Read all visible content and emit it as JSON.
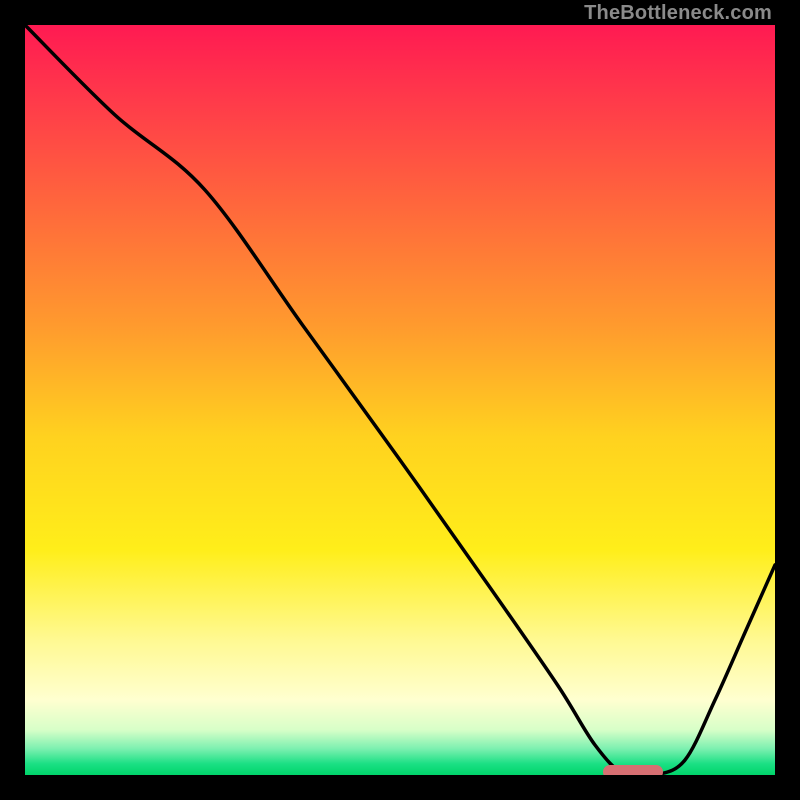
{
  "watermark": "TheBottleneck.com",
  "colors": {
    "frame": "#000000",
    "curve": "#000000",
    "marker": "#d66f72",
    "gradient_stops": [
      {
        "offset": 0,
        "color": "#ff1a52"
      },
      {
        "offset": 0.1,
        "color": "#ff3a4a"
      },
      {
        "offset": 0.25,
        "color": "#ff6a3b"
      },
      {
        "offset": 0.4,
        "color": "#ff9a2e"
      },
      {
        "offset": 0.55,
        "color": "#ffd21f"
      },
      {
        "offset": 0.7,
        "color": "#ffee1a"
      },
      {
        "offset": 0.82,
        "color": "#fff992"
      },
      {
        "offset": 0.9,
        "color": "#ffffd0"
      },
      {
        "offset": 0.94,
        "color": "#d7ffc8"
      },
      {
        "offset": 0.965,
        "color": "#7cf0b0"
      },
      {
        "offset": 0.985,
        "color": "#1be084"
      },
      {
        "offset": 1.0,
        "color": "#00d46a"
      }
    ]
  },
  "chart_data": {
    "type": "line",
    "title": "",
    "xlabel": "",
    "ylabel": "",
    "xlim": [
      0,
      100
    ],
    "ylim": [
      0,
      100
    ],
    "x": [
      0,
      12,
      24,
      37,
      50,
      62,
      71,
      76,
      80,
      84,
      88,
      92,
      96,
      100
    ],
    "values": [
      100,
      88,
      78,
      60,
      42,
      25,
      12,
      4,
      0,
      0,
      2,
      10,
      19,
      28
    ],
    "marker": {
      "x_start": 77,
      "x_end": 85,
      "y": 0
    },
    "legend": null,
    "grid": false
  }
}
